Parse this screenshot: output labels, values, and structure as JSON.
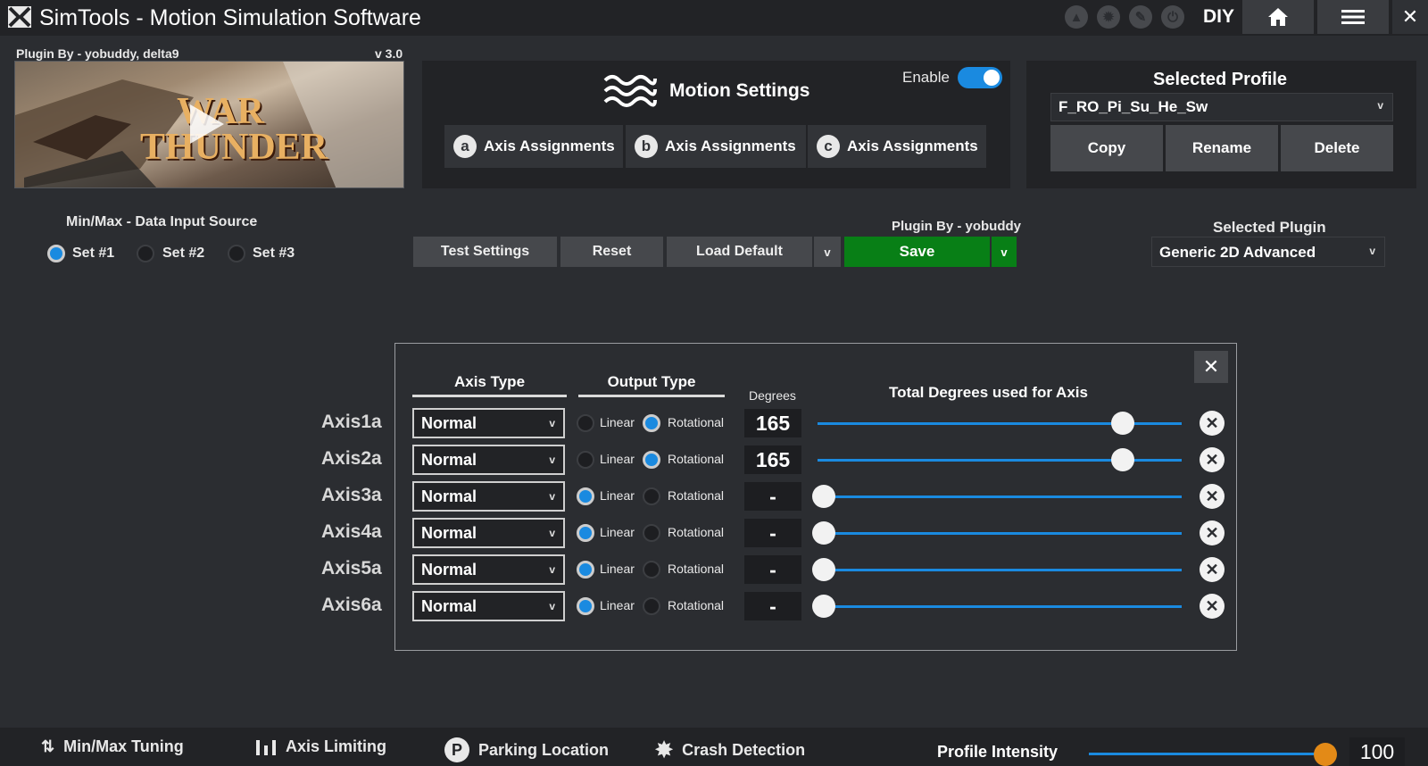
{
  "titlebar": {
    "title": "SimTools - Motion Simulation Software",
    "diy_label": "DIY",
    "icons": [
      "upload-icon",
      "gear-icon",
      "wrench-icon",
      "power-icon",
      "home-icon",
      "menu-icon",
      "close-icon"
    ]
  },
  "plugin_preview": {
    "plugin_by": "Plugin By - yobuddy, delta9",
    "version": "v 3.0",
    "game_name": "WAR THUNDER"
  },
  "motion_settings": {
    "title": "Motion Settings",
    "enable_label": "Enable",
    "enabled": true,
    "tabs": [
      {
        "badge": "a",
        "label": "Axis Assignments"
      },
      {
        "badge": "b",
        "label": "Axis Assignments"
      },
      {
        "badge": "c",
        "label": "Axis Assignments"
      }
    ]
  },
  "profile": {
    "title": "Selected Profile",
    "selected": "F_RO_Pi_Su_He_Sw",
    "copy_label": "Copy",
    "rename_label": "Rename",
    "delete_label": "Delete"
  },
  "data_input": {
    "title": "Min/Max - Data Input Source",
    "sets": [
      {
        "label": "Set #1",
        "selected": true
      },
      {
        "label": "Set #2",
        "selected": false
      },
      {
        "label": "Set #3",
        "selected": false
      }
    ]
  },
  "actions": {
    "test_label": "Test Settings",
    "reset_label": "Reset",
    "load_default_label": "Load Default",
    "dropdown_glyph": "v",
    "plugin_author": "Plugin By - yobuddy",
    "save_label": "Save"
  },
  "plugin": {
    "title": "Selected Plugin",
    "selected": "Generic 2D Advanced"
  },
  "axis_dialog": {
    "col_axis_type": "Axis Type",
    "col_output_type": "Output Type",
    "col_degrees": "Degrees",
    "col_total": "Total Degrees used for Axis",
    "linear_label": "Linear",
    "rotational_label": "Rotational",
    "axes": [
      {
        "name": "Axis1a",
        "type": "Normal",
        "output": "Rotational",
        "degrees": "165",
        "slider": 0.92
      },
      {
        "name": "Axis2a",
        "type": "Normal",
        "output": "Rotational",
        "degrees": "165",
        "slider": 0.92
      },
      {
        "name": "Axis3a",
        "type": "Normal",
        "output": "Linear",
        "degrees": "-",
        "slider": 0
      },
      {
        "name": "Axis4a",
        "type": "Normal",
        "output": "Linear",
        "degrees": "-",
        "slider": 0
      },
      {
        "name": "Axis5a",
        "type": "Normal",
        "output": "Linear",
        "degrees": "-",
        "slider": 0
      },
      {
        "name": "Axis6a",
        "type": "Normal",
        "output": "Linear",
        "degrees": "-",
        "slider": 0
      }
    ]
  },
  "bottombar": {
    "minmax_label": "Min/Max Tuning",
    "axis_limiting_label": "Axis Limiting",
    "parking_label": "Parking Location",
    "crash_label": "Crash Detection",
    "intensity_label": "Profile Intensity",
    "intensity_value": "100",
    "intensity_fraction": 1.0
  },
  "colors": {
    "accent": "#1a8ae0",
    "save_green": "#087f16",
    "intensity_knob": "#e38a17"
  }
}
